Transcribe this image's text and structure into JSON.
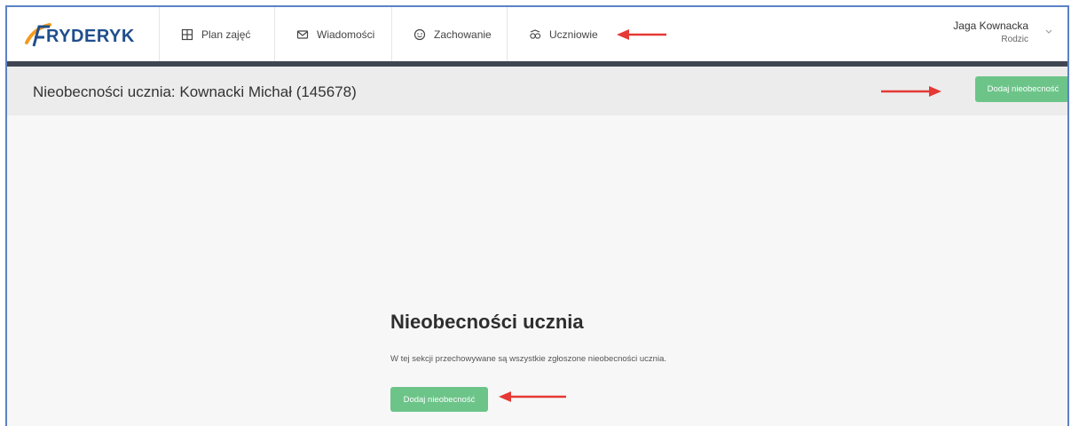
{
  "app": {
    "logo_text": "RYDERYK",
    "logo_glyph": "F"
  },
  "nav": [
    {
      "label": "Plan zajęć",
      "icon": "grid-icon"
    },
    {
      "label": "Wiadomości",
      "icon": "envelope-icon"
    },
    {
      "label": "Zachowanie",
      "icon": "smiley-icon"
    },
    {
      "label": "Uczniowie",
      "icon": "students-icon"
    }
  ],
  "user": {
    "name": "Jaga Kownacka",
    "role": "Rodzic"
  },
  "page": {
    "title": "Nieobecności ucznia: Kownacki Michał (145678)",
    "add_button_label": "Dodaj nieobecność"
  },
  "empty_state": {
    "title": "Nieobecności ucznia",
    "description": "W tej sekcji przechowywane są wszystkie zgłoszone nieobecności ucznia.",
    "button_label": "Dodaj nieobecność"
  },
  "colors": {
    "accent_green": "#6cc489",
    "brand_blue": "#1f4e8c",
    "brand_orange": "#f39a1e",
    "annotation_red": "#e53935",
    "dark_band": "#3f4652"
  }
}
